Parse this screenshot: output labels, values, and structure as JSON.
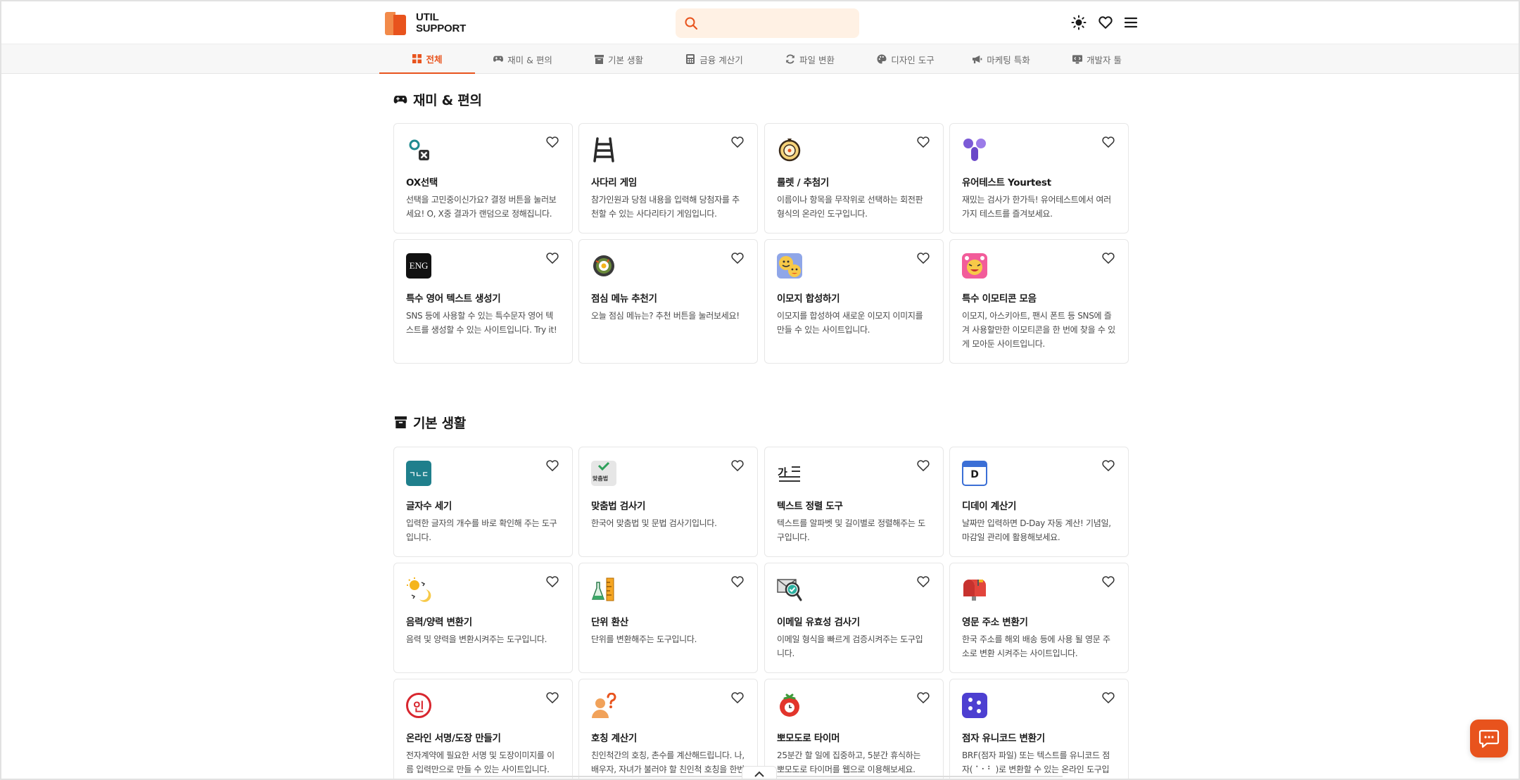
{
  "header": {
    "logo_line1": "UTIL",
    "logo_line2": "SUPPORT",
    "search_placeholder": "",
    "icons": [
      "sun-icon",
      "heart-icon",
      "menu-icon"
    ]
  },
  "tabs": [
    {
      "label": "전체",
      "icon": "grid-icon",
      "active": true
    },
    {
      "label": "재미 & 편의",
      "icon": "gamepad-icon",
      "active": false
    },
    {
      "label": "기본 생활",
      "icon": "archive-icon",
      "active": false
    },
    {
      "label": "금융 계산기",
      "icon": "calculator-icon",
      "active": false
    },
    {
      "label": "파일 변환",
      "icon": "refresh-icon",
      "active": false
    },
    {
      "label": "디자인 도구",
      "icon": "palette-icon",
      "active": false
    },
    {
      "label": "마케팅 특화",
      "icon": "megaphone-icon",
      "active": false
    },
    {
      "label": "개발자 툴",
      "icon": "monitor-code-icon",
      "active": false
    }
  ],
  "sections": [
    {
      "title": "재미 & 편의",
      "icon": "gamepad-icon",
      "cards": [
        {
          "name": "OX선택",
          "desc": "선택을 고민중이신가요? 결정 버튼을 눌러보세요! O, X중 결과가 랜덤으로 정해집니다.",
          "icon": "ox-icon"
        },
        {
          "name": "사다리 게임",
          "desc": "참가인원과 당첨 내용을 입력해 당첨자를 추천할 수 있는 사다리타기 게임입니다.",
          "icon": "ladder-icon"
        },
        {
          "name": "룰렛 / 추첨기",
          "desc": "이름이나 항목을 무작위로 선택하는 회전판 형식의 온라인 도구입니다.",
          "icon": "roulette-icon"
        },
        {
          "name": "유어테스트 Yourtest",
          "desc": "재밌는 검사가 한가득! 유어테스트에서 여러가지 테스트를 즐겨보세요.",
          "icon": "yourtest-logo-icon"
        },
        {
          "name": "특수 영어 텍스트 생성기",
          "desc": "SNS 등에 사용할 수 있는 특수문자 영어 텍스트를 생성할 수 있는 사이트입니다. Try it!",
          "icon": "eng-icon",
          "icon_text": "ENG"
        },
        {
          "name": "점심 메뉴 추천기",
          "desc": "오늘 점심 메뉴는? 추천 버튼을 눌러보세요!",
          "icon": "bibimbap-icon"
        },
        {
          "name": "이모지 합성하기",
          "desc": "이모지를 합성하여 새로운 이모지 이미지를 만들 수 있는 사이트입니다.",
          "icon": "emoji-mix-icon"
        },
        {
          "name": "특수 이모티콘 모음",
          "desc": "이모지, 아스키아트, 팬시 폰트 등 SNS에 즐겨 사용할만한 이모티콘을 한 번에 찾을 수 있게 모아둔 사이트입니다.",
          "icon": "emoticon-icon"
        }
      ]
    },
    {
      "title": "기본 생활",
      "icon": "archive-icon",
      "cards": [
        {
          "name": "글자수 세기",
          "desc": "입력한 글자의 개수를 바로 확인해 주는 도구입니다.",
          "icon": "char-count-icon",
          "icon_text": "ㄱㄴㄷ"
        },
        {
          "name": "맞춤법 검사기",
          "desc": "한국어 맞춤법 및 문법 검사기입니다.",
          "icon": "spellcheck-icon",
          "icon_text": "맞춤법"
        },
        {
          "name": "텍스트 정렬 도구",
          "desc": "텍스트를 알파벳 및 길이별로 정렬해주는 도구입니다.",
          "icon": "text-sort-icon",
          "icon_text": "가"
        },
        {
          "name": "디데이 계산기",
          "desc": "날짜만 입력하면 D-Day 자동 계산! 기념일, 마감일 관리에 활용해보세요.",
          "icon": "dday-calendar-icon",
          "icon_text": "D"
        },
        {
          "name": "음력/양력 변환기",
          "desc": "음력 및 양력을 변환시켜주는 도구입니다.",
          "icon": "sun-moon-icon"
        },
        {
          "name": "단위 환산",
          "desc": "단위를 변환해주는 도구입니다.",
          "icon": "ruler-flask-icon"
        },
        {
          "name": "이메일 유효성 검사기",
          "desc": "이메일 형식을 빠르게 검증시켜주는 도구입니다.",
          "icon": "email-check-icon"
        },
        {
          "name": "영문 주소 변환기",
          "desc": "한국 주소를 해외 배송 등에 사용 될 영문 주소로 변환 시켜주는 사이트입니다.",
          "icon": "mailbox-icon"
        },
        {
          "name": "온라인 서명/도장 만들기",
          "desc": "전자계약에 필요한 서명 및 도장이미지를 이름 입력만으로 만들 수 있는 사이트입니다.",
          "icon": "stamp-icon",
          "icon_text": "인"
        },
        {
          "name": "호칭 계산기",
          "desc": "친인척간의 호칭, 촌수를 계산해드립니다. 나, 배우자, 자녀가 불러야 할 친인척 호칭을 한번",
          "icon": "person-question-icon"
        },
        {
          "name": "뽀모도로 타이머",
          "desc": "25분간 할 일에 집중하고, 5분간 휴식하는 뽀모도로 타이머를 웹으로 이용해보세요.",
          "icon": "tomato-icon"
        },
        {
          "name": "점자 유니코드 변환기",
          "desc": "BRF(점자 파일) 또는 텍스트를 유니코드 점자( ⠁⠂⠃ )로 변환할 수 있는 온라인 도구입니다.",
          "icon": "braille-icon"
        }
      ]
    }
  ],
  "colors": {
    "accent": "#e8531d",
    "search_bg": "#fff1e4",
    "card_border": "#e7e7e7"
  }
}
